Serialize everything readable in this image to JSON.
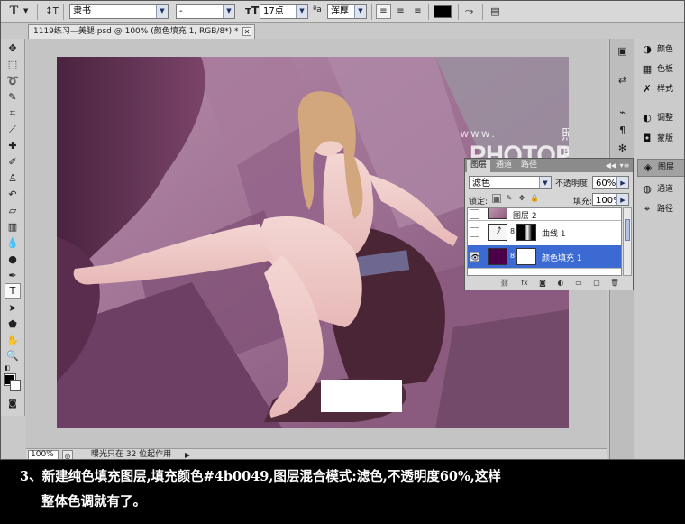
{
  "options_bar": {
    "tool_glyph": "T",
    "font_family": "隶书",
    "font_style": "-",
    "font_size": "17点",
    "antialias_label": "ªa",
    "antialias": "浑厚",
    "text_color": "#000000"
  },
  "document": {
    "tab_title": "1119练习—美腿.psd @ 100% (颜色填充 1, RGB/8*) *",
    "close_glyph": "✕"
  },
  "watermark": {
    "en": "www.",
    "cn": "照片处理网",
    "domain": "PHOTOPS.COM"
  },
  "status": {
    "zoom": "100%",
    "text": "曝光只在 32 位起作用",
    "arrow": "▶"
  },
  "right_panels": {
    "items": [
      {
        "label": "颜色",
        "icon": "color-icon",
        "glyph": "◑"
      },
      {
        "label": "色板",
        "icon": "swatches-icon",
        "glyph": "▦"
      },
      {
        "label": "样式",
        "icon": "styles-icon",
        "glyph": "✗"
      },
      {
        "label": "调整",
        "icon": "adjustments-icon",
        "glyph": "◐"
      },
      {
        "label": "蒙版",
        "icon": "masks-icon",
        "glyph": "◘"
      },
      {
        "label": "图层",
        "icon": "layers-icon",
        "glyph": "◈"
      },
      {
        "label": "通道",
        "icon": "channels-icon",
        "glyph": "◍"
      },
      {
        "label": "路径",
        "icon": "paths-icon",
        "glyph": "⌖"
      }
    ]
  },
  "layers_panel": {
    "tabs": [
      "图层",
      "通道",
      "路径"
    ],
    "collapse_glyph": "◀◀",
    "menu_glyph": "▾≡",
    "blend_mode": "滤色",
    "opacity_label": "不透明度:",
    "opacity": "60%",
    "lock_label": "锁定:",
    "fill_label": "填充:",
    "fill": "100%",
    "layers": [
      {
        "name": "图层 2",
        "visible": false,
        "selected": false
      },
      {
        "name": "曲线 1",
        "visible": false,
        "selected": false
      },
      {
        "name": "颜色填充 1",
        "visible": true,
        "selected": true
      }
    ],
    "fill_color": "#4b0049"
  },
  "caption": {
    "line1": "3、新建纯色填充图层,填充颜色#4b0049,图层混合模式:滤色,不透明度60%,这样",
    "line2": "整体色调就有了。"
  }
}
